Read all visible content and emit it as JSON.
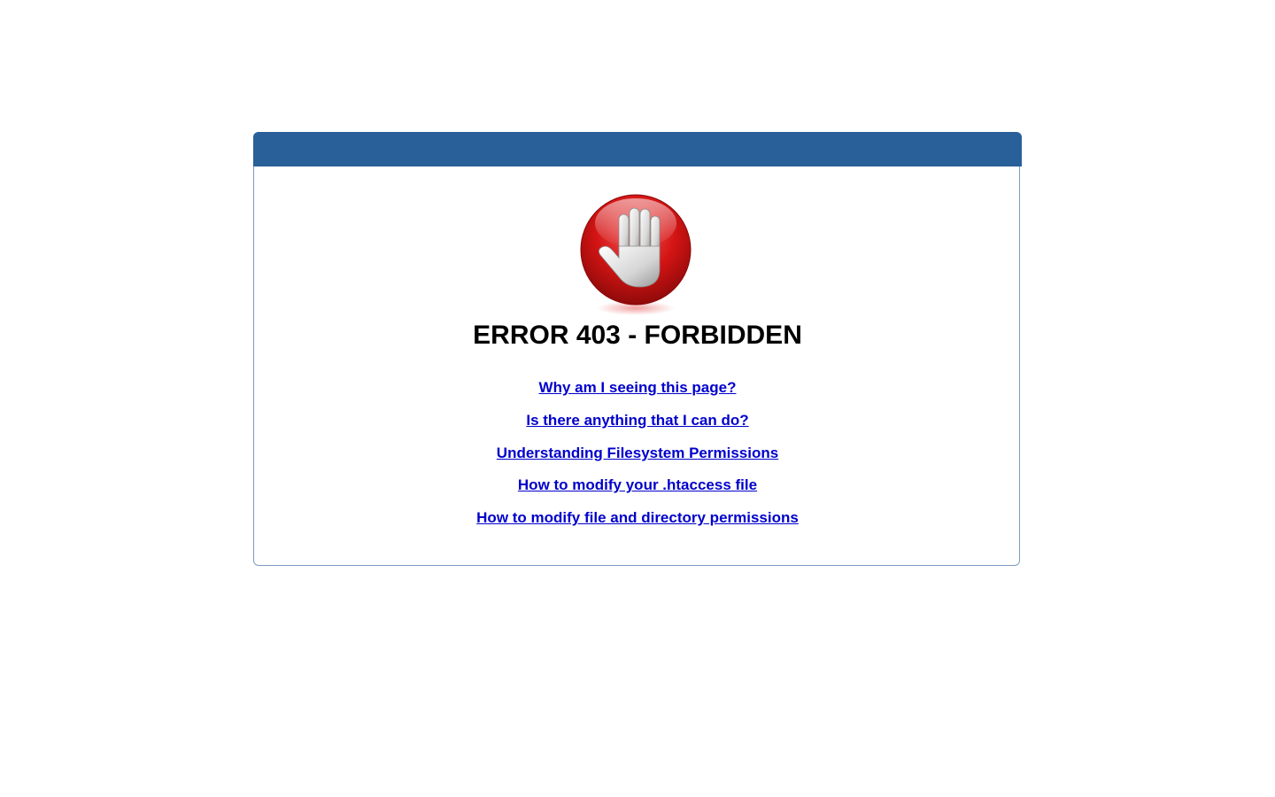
{
  "header": {
    "color": "#2a6099"
  },
  "icon": {
    "name": "stop-hand-icon"
  },
  "error": {
    "title": "ERROR 403 - FORBIDDEN"
  },
  "links": [
    {
      "label": "Why am I seeing this page?"
    },
    {
      "label": "Is there anything that I can do?"
    },
    {
      "label": "Understanding Filesystem Permissions"
    },
    {
      "label": "How to modify your .htaccess file"
    },
    {
      "label": "How to modify file and directory permissions"
    }
  ],
  "colors": {
    "link": "#0000cc",
    "border": "#7e9bbe",
    "icon_red": "#d41414"
  }
}
